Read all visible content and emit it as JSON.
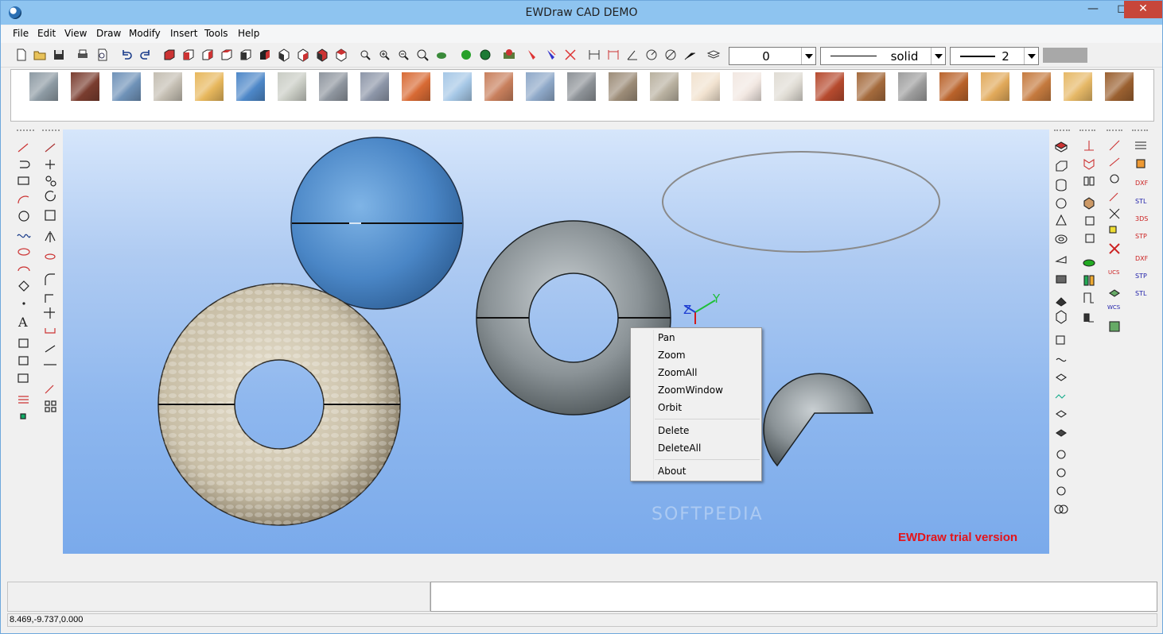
{
  "window": {
    "title": "EWDraw CAD DEMO"
  },
  "menu": [
    "File",
    "Edit",
    "View",
    "Draw",
    "Modify",
    "Insert",
    "Tools",
    "Help"
  ],
  "toolbar": {
    "layer_value": "0",
    "linetype_value": "solid",
    "lineweight_value": "2",
    "color_swatch": "#a8a8a8"
  },
  "materials": [
    "#8d9aa3",
    "#7a3d2f",
    "#6f92b8",
    "#c4beb2",
    "#e7b75c",
    "#4d87c8",
    "#c9ccc4",
    "#8e959e",
    "#8d96a8",
    "#d86a34",
    "#a5c7e6",
    "#c87f5c",
    "#8ea8c8",
    "#8d9297",
    "#9c8c78",
    "#b9b1a0",
    "#f1e2cf",
    "#f2e8e2",
    "#e0dcd4",
    "#b64a2e",
    "#a46a3c",
    "#9d9d9d",
    "#b9622a",
    "#e1a95a",
    "#c57a3e",
    "#e6b866",
    "#9a6030"
  ],
  "canvas": {
    "trial_text": "EWDraw trial version",
    "watermark": "SOFTPEDIA",
    "axis": {
      "z": "Z",
      "y": "Y"
    }
  },
  "context_menu": {
    "items": [
      "Pan",
      "Zoom",
      "ZoomAll",
      "ZoomWindow",
      "Orbit",
      "Delete",
      "DeleteAll",
      "About"
    ]
  },
  "status": {
    "coords": "8.469,-9.737,0.000"
  },
  "colors": {
    "titlebar": "#8ec4f0",
    "close": "#c7463a",
    "canvas_top": "#d6e6fb",
    "canvas_bottom": "#7aaaeb",
    "trial": "#e4141a"
  }
}
